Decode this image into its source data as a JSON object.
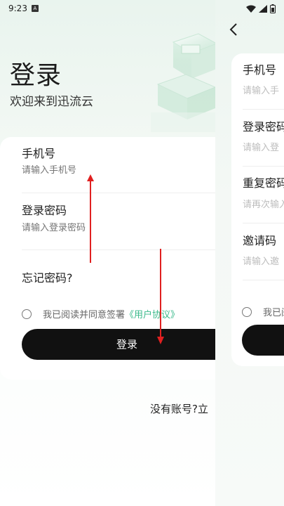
{
  "status_bar": {
    "time": "9:23",
    "notification_icon": "a-badge-icon",
    "icons": [
      "wifi-icon",
      "signal-icon",
      "battery-icon"
    ]
  },
  "login": {
    "title": "登录",
    "subtitle": "欢迎来到迅流云",
    "phone_label": "手机号",
    "phone_placeholder": "请输入手机号",
    "password_label": "登录密码",
    "password_placeholder": "请输入登录密码",
    "forgot_password": "忘记密码?",
    "agree_text": "我已阅读并同意签署",
    "agreement_link": "《用户协议》",
    "login_button": "登录",
    "register_prompt": "没有账号?立"
  },
  "register": {
    "phone_label": "手机号",
    "phone_placeholder": "请输入手",
    "password_label": "登录密码",
    "password_placeholder": "请输入登",
    "repeat_label": "重复密码",
    "repeat_placeholder": "请再次输入",
    "invite_label": "邀请码",
    "invite_placeholder": "请输入邀",
    "agree_text": "我已阅"
  },
  "colors": {
    "accent_green": "#39b98a",
    "button_dark": "#111111",
    "annotation_red": "#e02020"
  }
}
